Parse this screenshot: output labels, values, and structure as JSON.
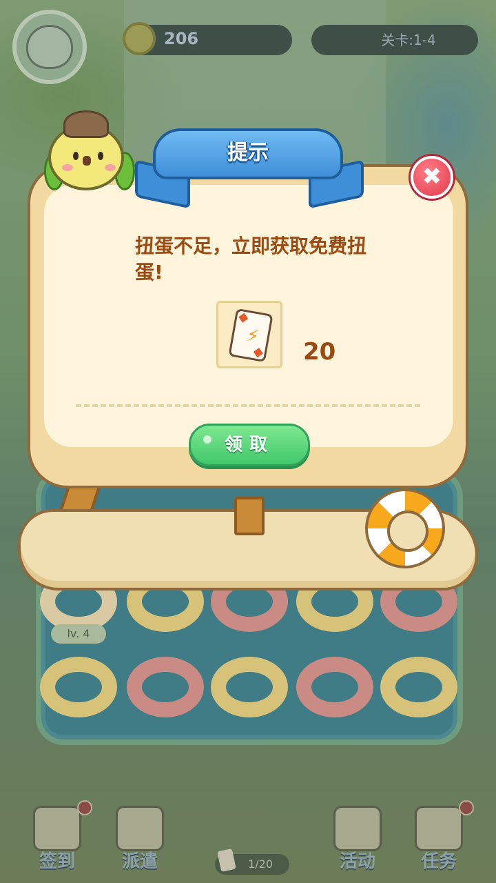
{
  "hud": {
    "coins": "206",
    "level": "关卡:1-4"
  },
  "board": {
    "level_badge": "lv. 4"
  },
  "dialog": {
    "title": "提示",
    "close_symbol": "✖",
    "message": "扭蛋不足，立即获取免费扭蛋!",
    "reward": {
      "icon": "gacha-card-icon",
      "amount": "20"
    },
    "claim_label": "领取"
  },
  "bottom_nav": {
    "items": [
      {
        "label": "签到",
        "icon": "calendar-icon"
      },
      {
        "label": "派遣",
        "icon": "crossed-swords-icon"
      },
      {
        "label": "活动",
        "icon": "megaphone-icon"
      },
      {
        "label": "任务",
        "icon": "scroll-icon"
      }
    ],
    "card_count": "1/20"
  },
  "colors": {
    "accent_green": "#42c86c",
    "title_blue": "#3f8fd8",
    "close_red": "#e23a4e",
    "text_brown": "#9b4b12"
  }
}
